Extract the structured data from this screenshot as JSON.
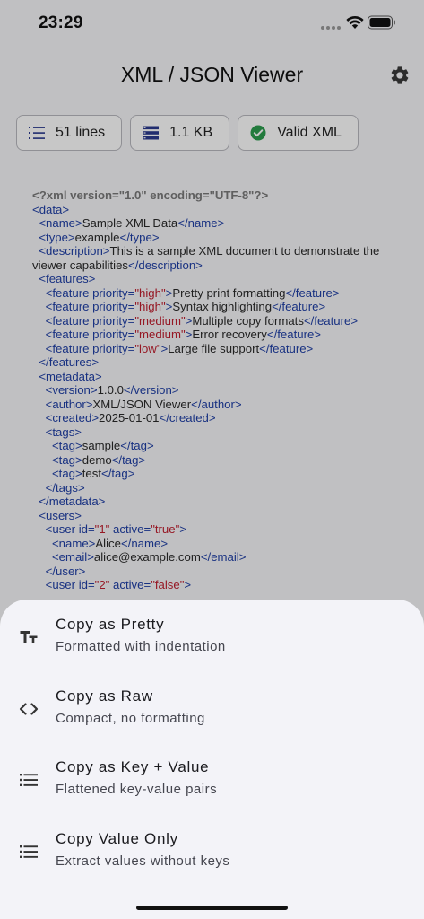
{
  "status": {
    "time": "23:29"
  },
  "app": {
    "title": "XML / JSON Viewer"
  },
  "chips": [
    {
      "label": "51 lines",
      "icon": "list-numbered-icon"
    },
    {
      "label": "1.1 KB",
      "icon": "storage-icon"
    },
    {
      "label": "Valid XML",
      "icon": "check-circle-icon"
    }
  ],
  "code_lines": [
    [
      {
        "t": "decl",
        "s": "<?xml version=\"1.0\" encoding=\"UTF-8\"?>"
      }
    ],
    [
      {
        "t": "tag",
        "s": "<data>"
      }
    ],
    [
      {
        "t": "text",
        "s": "  "
      },
      {
        "t": "tag",
        "s": "<name>"
      },
      {
        "t": "text",
        "s": "Sample XML Data"
      },
      {
        "t": "tag",
        "s": "</name>"
      }
    ],
    [
      {
        "t": "text",
        "s": "  "
      },
      {
        "t": "tag",
        "s": "<type>"
      },
      {
        "t": "text",
        "s": "example"
      },
      {
        "t": "tag",
        "s": "</type>"
      }
    ],
    [
      {
        "t": "text",
        "s": "  "
      },
      {
        "t": "tag",
        "s": "<description>"
      },
      {
        "t": "text",
        "s": "This is a sample XML document to demonstrate the viewer capabilities"
      },
      {
        "t": "tag",
        "s": "</description>"
      }
    ],
    [
      {
        "t": "text",
        "s": "  "
      },
      {
        "t": "tag",
        "s": "<features>"
      }
    ],
    [
      {
        "t": "text",
        "s": "    "
      },
      {
        "t": "tag",
        "s": "<feature "
      },
      {
        "t": "attr",
        "s": "priority="
      },
      {
        "t": "val",
        "s": "\"high\""
      },
      {
        "t": "tag",
        "s": ">"
      },
      {
        "t": "text",
        "s": "Pretty print formatting"
      },
      {
        "t": "tag",
        "s": "</feature>"
      }
    ],
    [
      {
        "t": "text",
        "s": "    "
      },
      {
        "t": "tag",
        "s": "<feature "
      },
      {
        "t": "attr",
        "s": "priority="
      },
      {
        "t": "val",
        "s": "\"high\""
      },
      {
        "t": "tag",
        "s": ">"
      },
      {
        "t": "text",
        "s": "Syntax highlighting"
      },
      {
        "t": "tag",
        "s": "</feature>"
      }
    ],
    [
      {
        "t": "text",
        "s": "    "
      },
      {
        "t": "tag",
        "s": "<feature "
      },
      {
        "t": "attr",
        "s": "priority="
      },
      {
        "t": "val",
        "s": "\"medium\""
      },
      {
        "t": "tag",
        "s": ">"
      },
      {
        "t": "text",
        "s": "Multiple copy formats"
      },
      {
        "t": "tag",
        "s": "</feature>"
      }
    ],
    [
      {
        "t": "text",
        "s": "    "
      },
      {
        "t": "tag",
        "s": "<feature "
      },
      {
        "t": "attr",
        "s": "priority="
      },
      {
        "t": "val",
        "s": "\"medium\""
      },
      {
        "t": "tag",
        "s": ">"
      },
      {
        "t": "text",
        "s": "Error recovery"
      },
      {
        "t": "tag",
        "s": "</feature>"
      }
    ],
    [
      {
        "t": "text",
        "s": "    "
      },
      {
        "t": "tag",
        "s": "<feature "
      },
      {
        "t": "attr",
        "s": "priority="
      },
      {
        "t": "val",
        "s": "\"low\""
      },
      {
        "t": "tag",
        "s": ">"
      },
      {
        "t": "text",
        "s": "Large file support"
      },
      {
        "t": "tag",
        "s": "</feature>"
      }
    ],
    [
      {
        "t": "text",
        "s": "  "
      },
      {
        "t": "tag",
        "s": "</features>"
      }
    ],
    [
      {
        "t": "text",
        "s": "  "
      },
      {
        "t": "tag",
        "s": "<metadata>"
      }
    ],
    [
      {
        "t": "text",
        "s": "    "
      },
      {
        "t": "tag",
        "s": "<version>"
      },
      {
        "t": "text",
        "s": "1.0.0"
      },
      {
        "t": "tag",
        "s": "</version>"
      }
    ],
    [
      {
        "t": "text",
        "s": "    "
      },
      {
        "t": "tag",
        "s": "<author>"
      },
      {
        "t": "text",
        "s": "XML/JSON Viewer"
      },
      {
        "t": "tag",
        "s": "</author>"
      }
    ],
    [
      {
        "t": "text",
        "s": "    "
      },
      {
        "t": "tag",
        "s": "<created>"
      },
      {
        "t": "text",
        "s": "2025-01-01"
      },
      {
        "t": "tag",
        "s": "</created>"
      }
    ],
    [
      {
        "t": "text",
        "s": "    "
      },
      {
        "t": "tag",
        "s": "<tags>"
      }
    ],
    [
      {
        "t": "text",
        "s": "      "
      },
      {
        "t": "tag",
        "s": "<tag>"
      },
      {
        "t": "text",
        "s": "sample"
      },
      {
        "t": "tag",
        "s": "</tag>"
      }
    ],
    [
      {
        "t": "text",
        "s": "      "
      },
      {
        "t": "tag",
        "s": "<tag>"
      },
      {
        "t": "text",
        "s": "demo"
      },
      {
        "t": "tag",
        "s": "</tag>"
      }
    ],
    [
      {
        "t": "text",
        "s": "      "
      },
      {
        "t": "tag",
        "s": "<tag>"
      },
      {
        "t": "text",
        "s": "test"
      },
      {
        "t": "tag",
        "s": "</tag>"
      }
    ],
    [
      {
        "t": "text",
        "s": "    "
      },
      {
        "t": "tag",
        "s": "</tags>"
      }
    ],
    [
      {
        "t": "text",
        "s": "  "
      },
      {
        "t": "tag",
        "s": "</metadata>"
      }
    ],
    [
      {
        "t": "text",
        "s": "  "
      },
      {
        "t": "tag",
        "s": "<users>"
      }
    ],
    [
      {
        "t": "text",
        "s": "    "
      },
      {
        "t": "tag",
        "s": "<user "
      },
      {
        "t": "attr",
        "s": "id="
      },
      {
        "t": "val",
        "s": "\"1\""
      },
      {
        "t": "attr",
        "s": " active="
      },
      {
        "t": "val",
        "s": "\"true\""
      },
      {
        "t": "tag",
        "s": ">"
      }
    ],
    [
      {
        "t": "text",
        "s": "      "
      },
      {
        "t": "tag",
        "s": "<name>"
      },
      {
        "t": "text",
        "s": "Alice"
      },
      {
        "t": "tag",
        "s": "</name>"
      }
    ],
    [
      {
        "t": "text",
        "s": "      "
      },
      {
        "t": "tag",
        "s": "<email>"
      },
      {
        "t": "text",
        "s": "alice@example.com"
      },
      {
        "t": "tag",
        "s": "</email>"
      }
    ],
    [
      {
        "t": "text",
        "s": "    "
      },
      {
        "t": "tag",
        "s": "</user>"
      }
    ],
    [
      {
        "t": "text",
        "s": "    "
      },
      {
        "t": "tag",
        "s": "<user "
      },
      {
        "t": "attr",
        "s": "id="
      },
      {
        "t": "val",
        "s": "\"2\""
      },
      {
        "t": "attr",
        "s": " active="
      },
      {
        "t": "val",
        "s": "\"false\""
      },
      {
        "t": "tag",
        "s": ">"
      }
    ]
  ],
  "sheet": {
    "items": [
      {
        "title": "Copy as Pretty",
        "subtitle": "Formatted with indentation",
        "icon": "text-format-icon"
      },
      {
        "title": "Copy as Raw",
        "subtitle": "Compact, no formatting",
        "icon": "code-icon"
      },
      {
        "title": "Copy as Key + Value",
        "subtitle": "Flattened key-value pairs",
        "icon": "list-icon"
      },
      {
        "title": "Copy Value Only",
        "subtitle": "Extract values without keys",
        "icon": "list-icon"
      }
    ]
  },
  "colors": {
    "tag": "#1f3fa6",
    "value": "#c01f2f",
    "valid": "#2e9e4f"
  }
}
